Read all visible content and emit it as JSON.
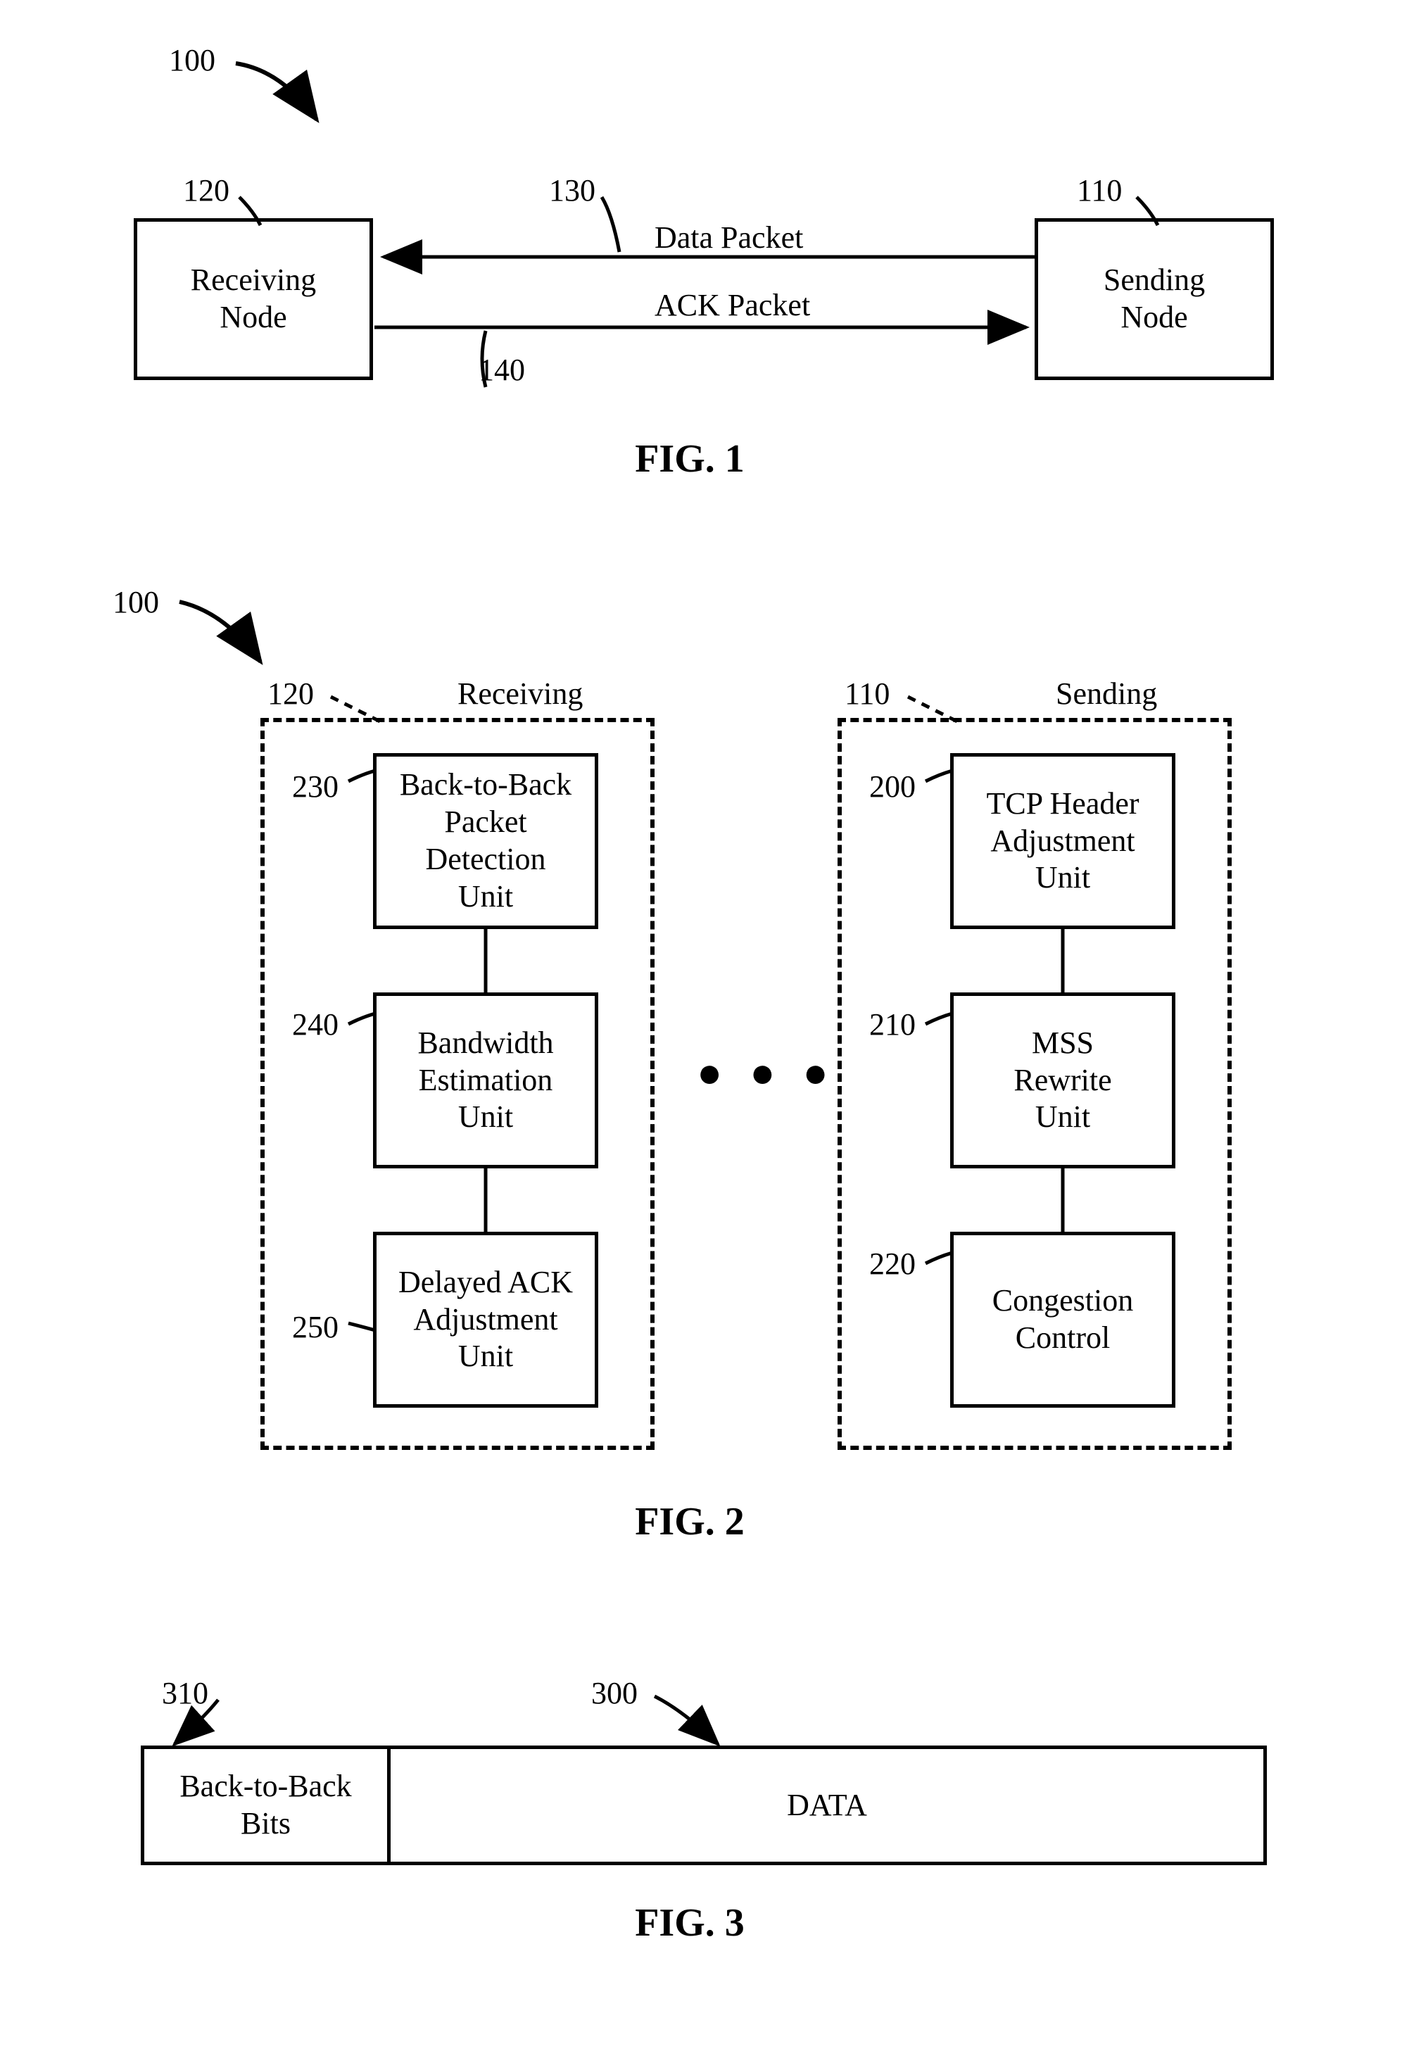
{
  "fig1": {
    "ref100": "100",
    "ref120": "120",
    "ref130": "130",
    "ref140": "140",
    "ref110": "110",
    "receivingNode": "Receiving\nNode",
    "sendingNode": "Sending\nNode",
    "dataPacket": "Data Packet",
    "ackPacket": "ACK Packet",
    "caption": "FIG. 1"
  },
  "fig2": {
    "ref100": "100",
    "ref120": "120",
    "ref110": "110",
    "receivingTitle": "Receiving",
    "sendingTitle": "Sending",
    "ref230": "230",
    "ref240": "240",
    "ref250": "250",
    "ref200": "200",
    "ref210": "210",
    "ref220": "220",
    "box230": "Back-to-Back\nPacket\nDetection\nUnit",
    "box240": "Bandwidth\nEstimation\nUnit",
    "box250": "Delayed ACK\nAdjustment\nUnit",
    "box200": "TCP Header\nAdjustment\nUnit",
    "box210": "MSS\nRewrite\nUnit",
    "box220": "Congestion\nControl",
    "dots": "● ● ●",
    "caption": "FIG. 2"
  },
  "fig3": {
    "ref310": "310",
    "ref300": "300",
    "backToBackBits": "Back-to-Back\nBits",
    "data": "DATA",
    "caption": "FIG. 3"
  }
}
